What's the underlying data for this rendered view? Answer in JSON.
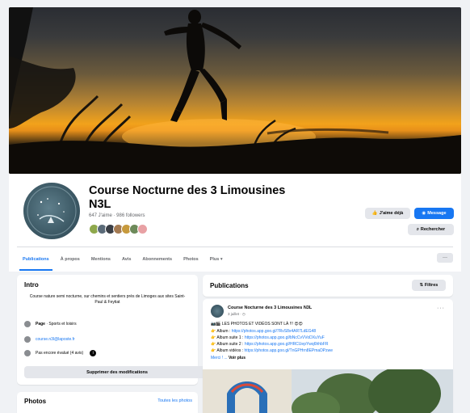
{
  "page": {
    "name": "Course Nocturne des 3 Limousines N3L",
    "stats": "647 J'aime · 986 followers"
  },
  "header_buttons": {
    "like": "J'aime déjà",
    "message": "Message",
    "search": "Rechercher"
  },
  "tabs": [
    {
      "label": "Publications",
      "active": true
    },
    {
      "label": "À propos",
      "active": false
    },
    {
      "label": "Mentions",
      "active": false
    },
    {
      "label": "Avis",
      "active": false
    },
    {
      "label": "Abonnements",
      "active": false
    },
    {
      "label": "Photos",
      "active": false
    },
    {
      "label": "Plus ▾",
      "active": false
    }
  ],
  "more_label": "···",
  "intro": {
    "title": "Intro",
    "description": "Course nature semi nocturne, sur chemins et sentiers près de Limoges aux sites Saint-Paul & Feytiat",
    "category_label": "Page",
    "category_value": "Sports et loisirs",
    "email": "course.n3l@laposte.fr",
    "rating": "Pas encore évalué (4 avis)",
    "info_symbol": "i",
    "edit_button": "Supprimer des modifications"
  },
  "photos": {
    "title": "Photos",
    "see_all": "Toutes les photos"
  },
  "publications": {
    "title": "Publications",
    "filter_button": "Filtres"
  },
  "post": {
    "author": "Course Nocturne des 3 Limousines N3L",
    "date": "3 juillet · ◷",
    "menu": "···",
    "headline": "📷🎬 LES PHOTOS ET VIDÉOS SONT LÀ !!! 😍😍",
    "lines": [
      {
        "label": "👉 Album : ",
        "url": "https://photos.app.goo.gl/7RvS8x4AR7LdEG48"
      },
      {
        "label": "👉 Album suite 1 : ",
        "url": "https://photos.app.goo.gl/bNcCvVVoDXuYuF"
      },
      {
        "label": "👉 Album suite 2 : ",
        "url": "https://photos.app.goo.gl/HRCUepYwq6hhbFR"
      },
      {
        "label": "👉 Album vidéos : ",
        "url": "https://photos.app.goo.gl/TnGPHrn8EPmaDPzwe"
      }
    ],
    "see_more_prefix": "Merci ! ... ",
    "see_more": "Voir plus"
  },
  "colors": {
    "brand_blue": "#1877f2",
    "background": "#f0f2f5",
    "secondary_text": "#65676b",
    "button_gray": "#e4e6eb"
  },
  "icons": {
    "like": "thumbs-up-icon",
    "message": "messenger-icon",
    "search": "search-icon",
    "category": "flag-icon",
    "email": "email-icon",
    "rating": "star-icon",
    "filter": "filter-icon"
  }
}
